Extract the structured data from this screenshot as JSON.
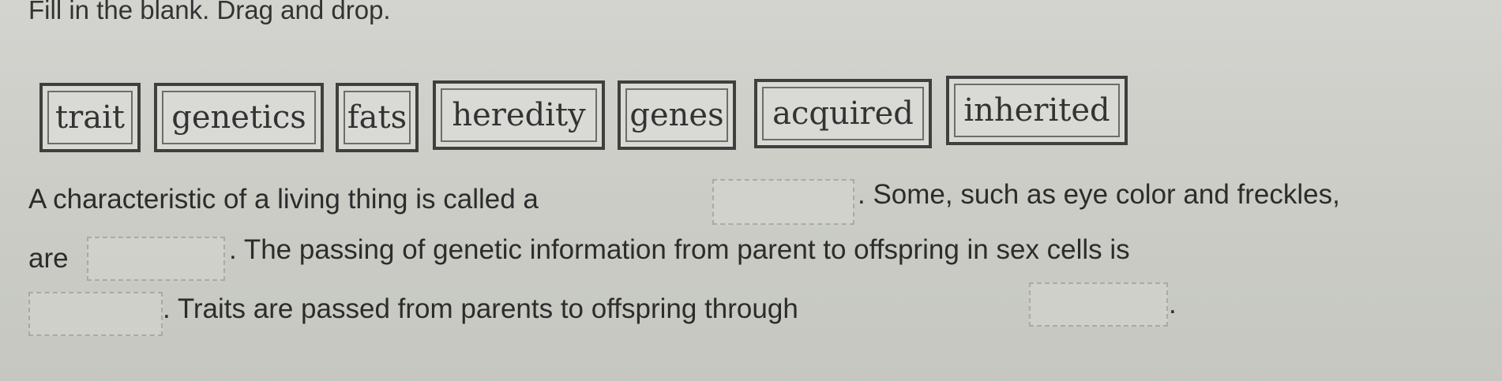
{
  "instruction": "Fill in the blank. Drag and drop.",
  "word_bank": [
    "trait",
    "genetics",
    "fats",
    "heredity",
    "genes",
    "acquired",
    "inherited"
  ],
  "passage": {
    "line1_start": "A characteristic of a living thing is called a",
    "line1_end": ". Some, such as eye color and freckles,",
    "line2_start": "are",
    "line2_end": ". The passing of genetic information from parent to offspring in sex cells is",
    "line3_end_a": ". Traits are passed from parents to offspring through",
    "line3_end_b": "."
  }
}
